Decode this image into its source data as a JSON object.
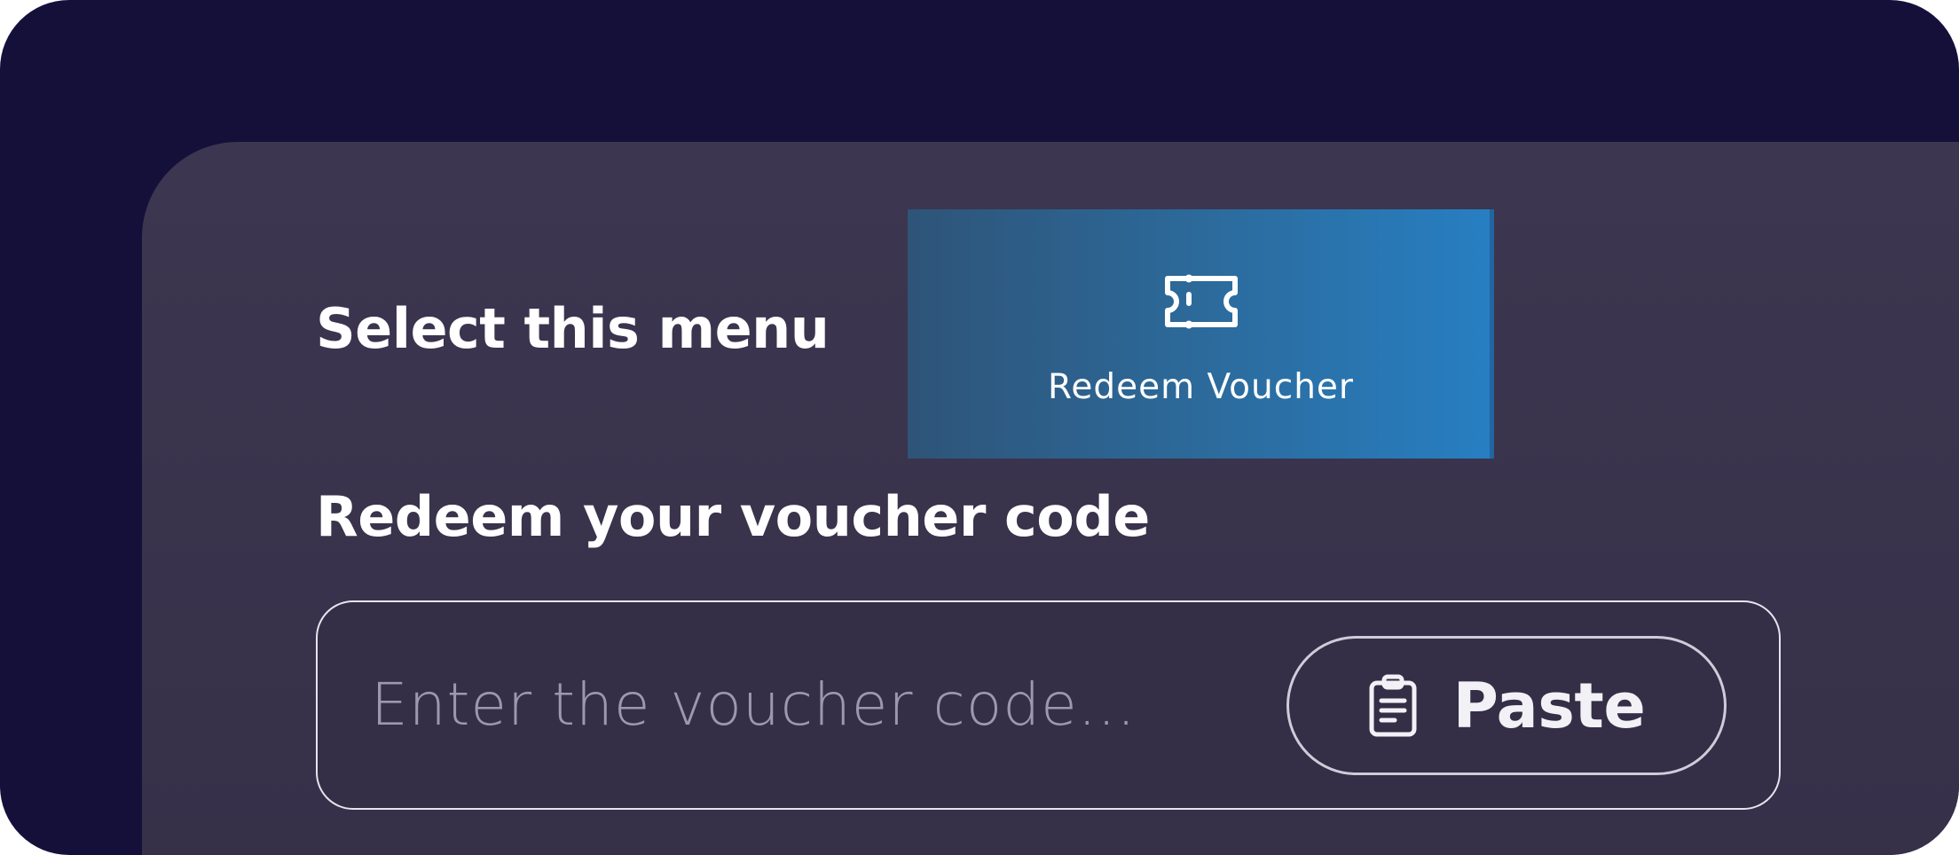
{
  "instructions": {
    "select_label": "Select this menu"
  },
  "menu_tile": {
    "icon": "ticket-icon",
    "label": "Redeem Voucher",
    "gradient": [
      "#2e5478",
      "#277fc2"
    ]
  },
  "redeem": {
    "heading": "Redeem your voucher code",
    "input_value": "",
    "input_placeholder": "Enter the voucher code...",
    "paste_icon": "clipboard-icon",
    "paste_label": "Paste"
  },
  "colors": {
    "background": "#15103a",
    "panel": "#3c3650",
    "text": "#ffffff",
    "placeholder": "#9c98b0"
  }
}
